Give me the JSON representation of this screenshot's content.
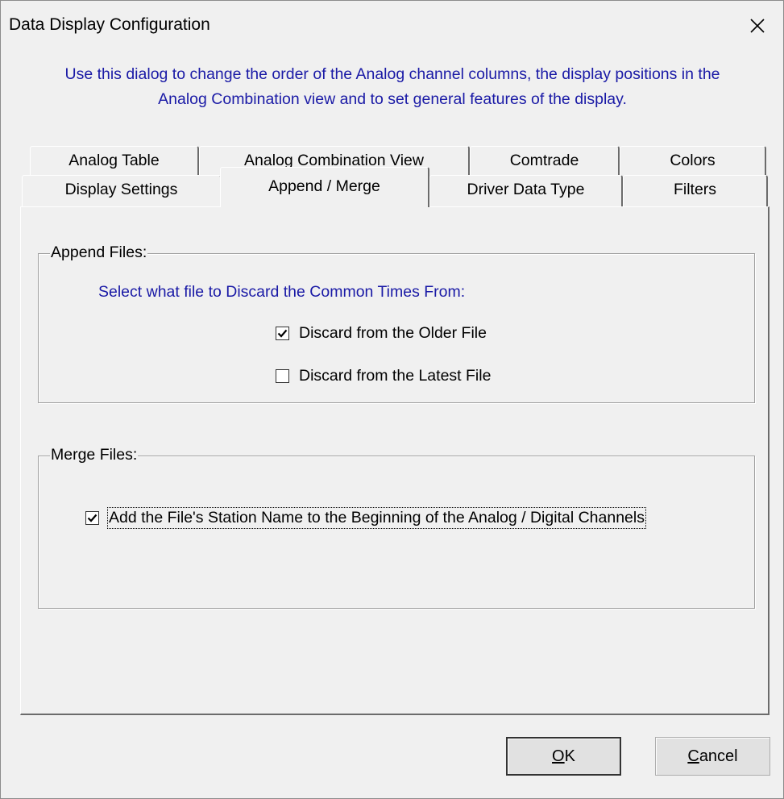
{
  "window": {
    "title": "Data Display Configuration"
  },
  "description": {
    "line1": "Use this dialog to change the order of the Analog channel columns, the display positions in the",
    "line2": "Analog Combination view and to set general features of the display."
  },
  "tabs": {
    "row1": [
      {
        "label": "Analog Table"
      },
      {
        "label": "Analog Combination View"
      },
      {
        "label": "Comtrade"
      },
      {
        "label": "Colors"
      }
    ],
    "row2": [
      {
        "label": "Display Settings"
      },
      {
        "label": "Append / Merge",
        "selected": true
      },
      {
        "label": "Driver Data Type"
      },
      {
        "label": "Filters"
      }
    ]
  },
  "append_files": {
    "legend": "Append Files:",
    "hint": "Select what file to Discard the Common Times From:",
    "options": [
      {
        "label": "Discard from the Older File",
        "checked": true
      },
      {
        "label": "Discard from the Latest File",
        "checked": false
      }
    ]
  },
  "merge_files": {
    "legend": "Merge Files:",
    "option": {
      "label": "Add the File's Station Name to the Beginning of the Analog / Digital Channels",
      "checked": true
    }
  },
  "buttons": {
    "ok_mnemonic": "O",
    "ok_rest": "K",
    "cancel_mnemonic": "C",
    "cancel_rest": "ancel"
  },
  "icons": {
    "close": "close-icon",
    "check": "check-icon"
  }
}
